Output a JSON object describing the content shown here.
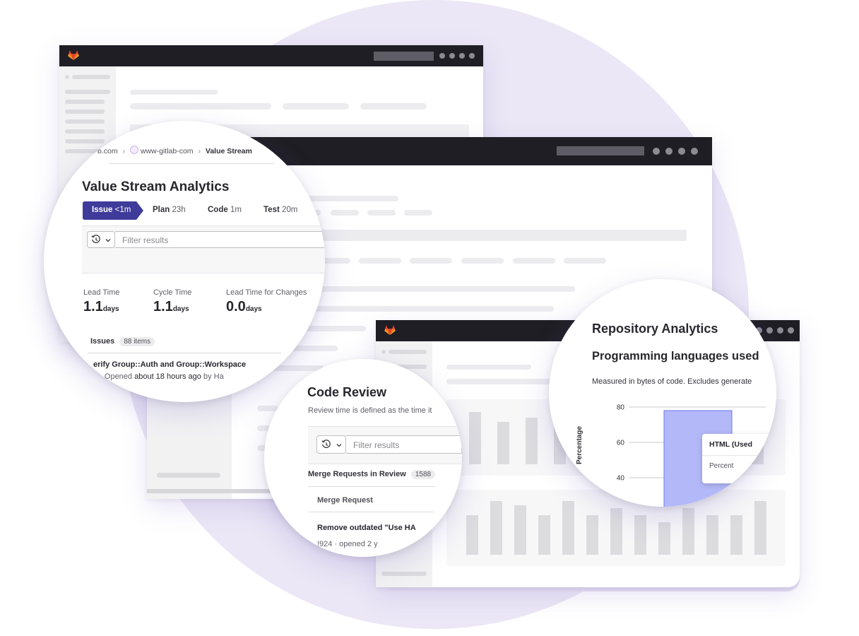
{
  "vsa": {
    "breadcrumb": {
      "group": "b.com",
      "project": "www-gitlab-com",
      "page": "Value Stream"
    },
    "title": "Value Stream Analytics",
    "stages": [
      {
        "name": "Issue",
        "time": "<1m"
      },
      {
        "name": "Plan",
        "time": "23h"
      },
      {
        "name": "Code",
        "time": "1m"
      },
      {
        "name": "Test",
        "time": "20m"
      }
    ],
    "filter_placeholder": "Filter results",
    "metrics": [
      {
        "label": "Lead Time",
        "value": "1.1",
        "unit": "days"
      },
      {
        "label": "Cycle Time",
        "value": "1.1",
        "unit": "days"
      },
      {
        "label": "Lead Time for Changes",
        "value": "0.0",
        "unit": "days"
      }
    ],
    "issues_label": "Issues",
    "issues_count": "88 items",
    "row_title": "erify Group::Auth and Group::Workspace",
    "row_meta_prefix": "2 · Opened ",
    "row_meta_time": "about 18 hours ago",
    "row_meta_suffix": " by Ha"
  },
  "code_review": {
    "title": "Code Review",
    "description": "Review time is defined as the time it",
    "filter_placeholder": "Filter results",
    "section_label": "Merge Requests in Review",
    "section_count": "1588",
    "column_header": "Merge Request",
    "row_title": "Remove outdated \"Use HA",
    "row_meta": "!924 · opened 2 y"
  },
  "repo": {
    "title": "Repository Analytics",
    "subtitle": "Programming languages used",
    "description": "Measured in bytes of code. Excludes generate",
    "y_axis_label": "Percentage",
    "tooltip_title": "HTML (Used",
    "tooltip_line": "Percent",
    "bar_color": "#b3b8f9",
    "chart_data": {
      "type": "bar",
      "categories": [
        "HTML"
      ],
      "values": [
        78
      ],
      "yticks": [
        40,
        60,
        80
      ],
      "ylim": [
        35,
        85
      ],
      "ylabel": "Percentage"
    }
  },
  "colors": {
    "accent": "#3f3b9b",
    "topbar": "#1f1e24",
    "logo": "#fc6d26",
    "backdrop": "#ebe7f6"
  },
  "icons": [
    "gitlab-logo-icon",
    "history-icon",
    "chevron-down-icon",
    "project-avatar-icon",
    "breadcrumb-chevron-icon"
  ]
}
